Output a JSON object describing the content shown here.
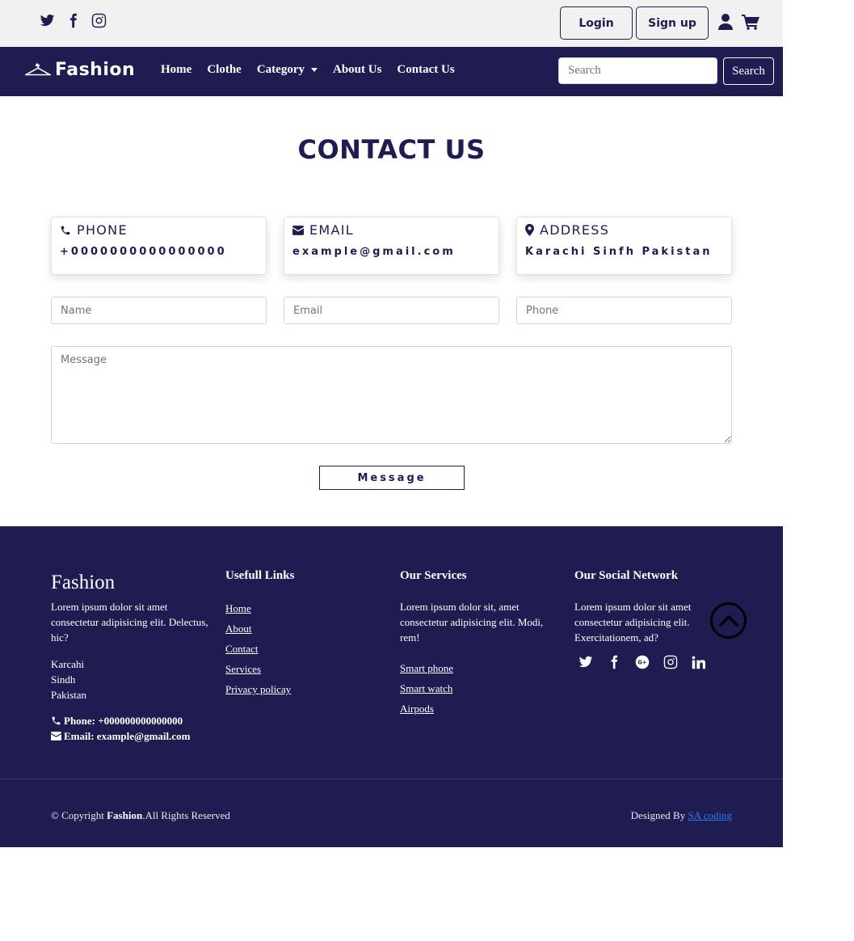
{
  "topbar": {
    "social": [
      "twitter-icon",
      "facebook-icon",
      "instagram-icon"
    ],
    "login_label": "Login",
    "signup_label": "Sign up"
  },
  "navbar": {
    "brand": "Fashion",
    "links": [
      "Home",
      "Clothe",
      "Category",
      "About Us",
      "Contact Us"
    ],
    "search_placeholder": "Search",
    "search_button": "Search"
  },
  "contact": {
    "title": "CONTACT US",
    "cards": [
      {
        "icon": "phone-icon",
        "heading": "PHONE",
        "value": "+0000000000000000"
      },
      {
        "icon": "envelope-icon",
        "heading": "EMAIL",
        "value": "example@gmail.com"
      },
      {
        "icon": "map-marker-icon",
        "heading": "ADDRESS",
        "value": "Karachi Sinfh Pakistan"
      }
    ],
    "form": {
      "name_placeholder": "Name",
      "email_placeholder": "Email",
      "phone_placeholder": "Phone",
      "message_placeholder": "Message",
      "submit_label": "Message"
    }
  },
  "footer": {
    "brand": "Fashion",
    "about": "Lorem ipsum dolor sit amet consectetur adipisicing elit. Delectus, hic?",
    "address": [
      "Karcahi",
      "Sindh",
      "Pakistan"
    ],
    "phone": "Phone: +000000000000000",
    "email": "Email: example@gmail.com",
    "links_heading": "Usefull Links",
    "links": [
      "Home",
      "About",
      "Contact",
      "Services",
      "Privacy policay"
    ],
    "services_heading": "Our Services",
    "services_text": "Lorem ipsum dolor sit, amet consectetur adipisicing elit. Modi, rem!",
    "services": [
      "Smart phone",
      "Smart watch",
      "Airpods"
    ],
    "social_heading": "Our Social Network",
    "social_text": "Lorem ipsum dolor sit amet consectetur adipisicing elit. Exercitationem, ad?",
    "social_icons": [
      "twitter-icon",
      "facebook-icon",
      "google-plus-icon",
      "instagram-icon",
      "linkedin-icon"
    ],
    "copyright_prefix": "© Copyright ",
    "copyright_brand": "Fashion",
    "copyright_suffix": ".All Rights Reserved",
    "designed_by": "Designed By ",
    "designer": "SA coding"
  },
  "colors": {
    "primary": "#1e1c51",
    "topbar": "#f1f1f1",
    "link": "#2c7be5"
  }
}
